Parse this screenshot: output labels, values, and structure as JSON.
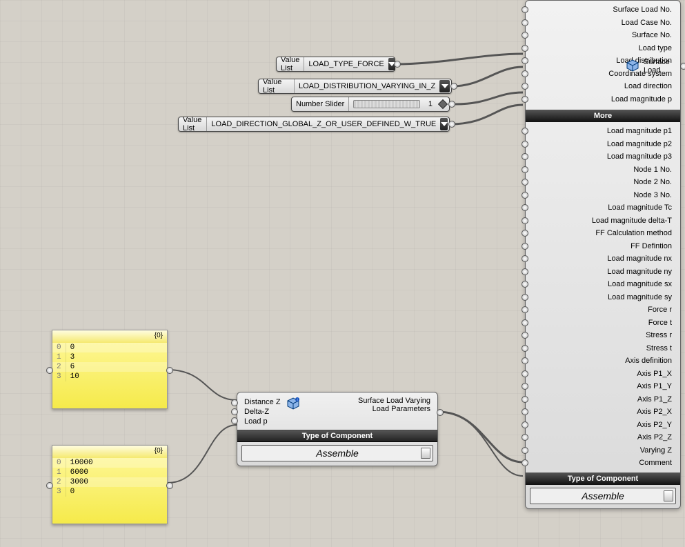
{
  "value_lists": {
    "vl1": {
      "label": "Value List",
      "value": "LOAD_TYPE_FORCE"
    },
    "vl2": {
      "label": "Value List",
      "value": "LOAD_DISTRIBUTION_VARYING_IN_Z"
    },
    "vl3": {
      "label": "Value List",
      "value": "LOAD_DIRECTION_GLOBAL_Z_OR_USER_DEFINED_W_TRUE"
    }
  },
  "slider": {
    "label": "Number Slider",
    "value": "1"
  },
  "panels": {
    "p1": {
      "branch": "{0}",
      "rows": [
        [
          "0",
          "0"
        ],
        [
          "1",
          "3"
        ],
        [
          "2",
          "6"
        ],
        [
          "3",
          "10"
        ]
      ]
    },
    "p2": {
      "branch": "{0}",
      "rows": [
        [
          "0",
          "10000"
        ],
        [
          "1",
          "6000"
        ],
        [
          "2",
          "3000"
        ],
        [
          "3",
          "0"
        ]
      ]
    }
  },
  "mid_comp": {
    "inputs": [
      "Distance Z",
      "Delta-Z",
      "Load p"
    ],
    "output": "Surface Load Varying Load Parameters",
    "type_bar": "Type of Component",
    "assemble": "Assemble"
  },
  "big_comp": {
    "inputs": [
      "Surface Load No.",
      "Load Case No.",
      "Surface No.",
      "Load type",
      "Load distribution",
      "Coordinate system",
      "Load direction",
      "Load magnitude p"
    ],
    "more_bar": "More",
    "output_label": "Surface Load",
    "more": [
      "Load magnitude p1",
      "Load magnitude p2",
      "Load magnitude p3",
      "Node 1 No.",
      "Node 2 No.",
      "Node 3 No.",
      "Load magnitude Tc",
      "Load magnitude delta-T",
      "FF Calculation method",
      "FF Defintion",
      "Load magnitude nx",
      "Load magnitude ny",
      "Load magnitude sx",
      "Load magnitude sy",
      "Force r",
      "Force t",
      "Stress r",
      "Stress t",
      "Axis definition",
      "Axis P1_X",
      "Axis P1_Y",
      "Axis P1_Z",
      "Axis P2_X",
      "Axis P2_Y",
      "Axis P2_Z",
      "Varying Z",
      "Comment"
    ],
    "type_bar": "Type of Component",
    "assemble": "Assemble"
  }
}
